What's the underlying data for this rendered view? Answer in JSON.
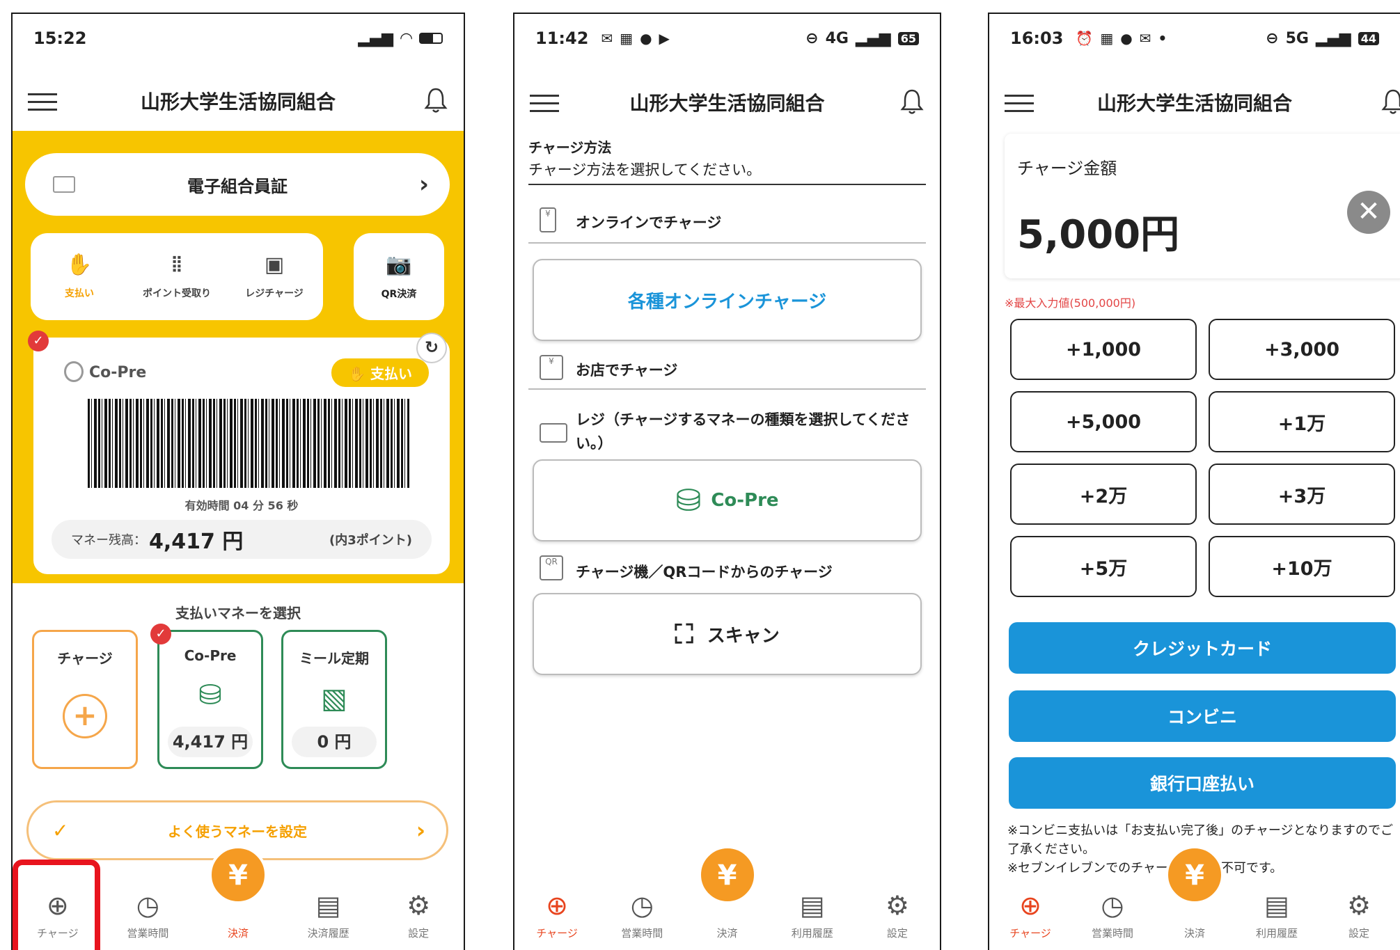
{
  "app_title": "山形大学生活協同組合",
  "panel1": {
    "time": "15:22",
    "member_card": "電子組合員証",
    "actions": [
      "支払い",
      "ポイント受取り",
      "レジチャージ"
    ],
    "qr_label": "QR決済",
    "card_title": "Co-Pre",
    "pay_badge": "支払い",
    "expiry": "有効時間 04 分 56 秒",
    "balance_label": "マネー残高：",
    "balance_value": "4,417 円",
    "points": "(内3ポイント)",
    "select_heading": "支払いマネーを選択",
    "money_cards": [
      {
        "label": "チャージ",
        "value": ""
      },
      {
        "label": "Co-Pre",
        "value": "4,417 円"
      },
      {
        "label": "ミール定期",
        "value": "0 円"
      }
    ],
    "favorite": "よく使うマネーを設定",
    "tabs": [
      "チャージ",
      "営業時間",
      "決済",
      "決済履歴",
      "設定"
    ]
  },
  "panel2": {
    "time": "11:42",
    "network": "4G",
    "battery": "65",
    "section_title": "チャージ方法",
    "section_sub": "チャージ方法を選択してください。",
    "online_label": "オンラインでチャージ",
    "online_button": "各種オンラインチャージ",
    "store_label": "お店でチャージ",
    "register_label": "レジ（チャージするマネーの種類を選択してください。）",
    "copre_button": "Co-Pre",
    "machine_label": "チャージ機／QRコードからのチャージ",
    "scan_button": "スキャン",
    "tabs": [
      "チャージ",
      "営業時間",
      "決済",
      "利用履歴",
      "設定"
    ]
  },
  "panel3": {
    "time": "16:03",
    "network": "5G",
    "battery": "44",
    "amount_label": "チャージ金額",
    "amount_value": "5,000円",
    "max_note": "※最大入力値(500,000円)",
    "add_buttons": [
      "+1,000",
      "+3,000",
      "+5,000",
      "+1万",
      "+2万",
      "+3万",
      "+5万",
      "+10万"
    ],
    "methods": [
      "クレジットカード",
      "コンビニ",
      "銀行口座払い"
    ],
    "note1": "※コンビニ支払いは「お支払い完了後」のチャージとなりますのでご了承ください。",
    "note2": "※セブンイレブンでのチャー",
    "note2_tail": "以上不可です。",
    "tabs": [
      "チャージ",
      "営業時間",
      "決済",
      "利用履歴",
      "設定"
    ]
  },
  "colors": {
    "accent_yellow": "#f7c500",
    "accent_orange": "#f59a23",
    "accent_blue": "#1a94d9",
    "active_tab": "#e8441e",
    "highlight_red": "#e8141e"
  }
}
